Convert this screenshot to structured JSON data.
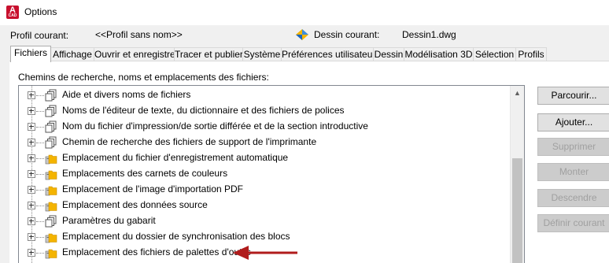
{
  "window": {
    "title": "Options",
    "app_icon_letter": "A",
    "app_icon_sub": "CAD"
  },
  "profile": {
    "current_label": "Profil courant:",
    "current_value": "<<Profil sans nom>>",
    "drawing_label": "Dessin courant:",
    "drawing_value": "Dessin1.dwg"
  },
  "tabs": [
    {
      "label": "Fichiers",
      "active": true
    },
    {
      "label": "Affichage"
    },
    {
      "label": "Ouvrir et enregistrer"
    },
    {
      "label": "Tracer et publier"
    },
    {
      "label": "Système"
    },
    {
      "label": "Préférences utilisateur"
    },
    {
      "label": "Dessin"
    },
    {
      "label": "Modélisation 3D"
    },
    {
      "label": "Sélection"
    },
    {
      "label": "Profils"
    }
  ],
  "files": {
    "section_label": "Chemins de recherche, noms et emplacements des fichiers:",
    "items": [
      {
        "label": "Aide et divers noms de fichiers",
        "icon": "multi-document-icon"
      },
      {
        "label": "Noms de l'éditeur de texte, du dictionnaire et des fichiers de polices",
        "icon": "multi-document-icon"
      },
      {
        "label": "Nom du fichier d'impression/de sortie différée et de la section introductive",
        "icon": "multi-document-icon"
      },
      {
        "label": "Chemin de recherche des fichiers de support de l'imprimante",
        "icon": "multi-document-icon"
      },
      {
        "label": "Emplacement du fichier d'enregistrement automatique",
        "icon": "folder-icon"
      },
      {
        "label": "Emplacements des carnets de couleurs",
        "icon": "folder-icon"
      },
      {
        "label": "Emplacement de l'image d'importation PDF",
        "icon": "folder-icon"
      },
      {
        "label": "Emplacement des données source",
        "icon": "folder-icon"
      },
      {
        "label": "Paramètres du gabarit",
        "icon": "multi-document-icon"
      },
      {
        "label": "Emplacement du dossier de synchronisation des blocs",
        "icon": "folder-icon"
      },
      {
        "label": "Emplacement des fichiers de palettes d'outils",
        "icon": "folder-icon"
      }
    ]
  },
  "buttons": {
    "browse": {
      "label": "Parcourir...",
      "enabled": true
    },
    "add": {
      "label": "Ajouter...",
      "enabled": true
    },
    "remove": {
      "label": "Supprimer",
      "enabled": false
    },
    "move_up": {
      "label": "Monter",
      "enabled": false
    },
    "move_down": {
      "label": "Descendre",
      "enabled": false
    },
    "set_current": {
      "label": "Définir courant",
      "enabled": false
    }
  },
  "colors": {
    "arrow": "#b01c1c",
    "folder": "#f4b400",
    "accent": "#c8102e"
  }
}
